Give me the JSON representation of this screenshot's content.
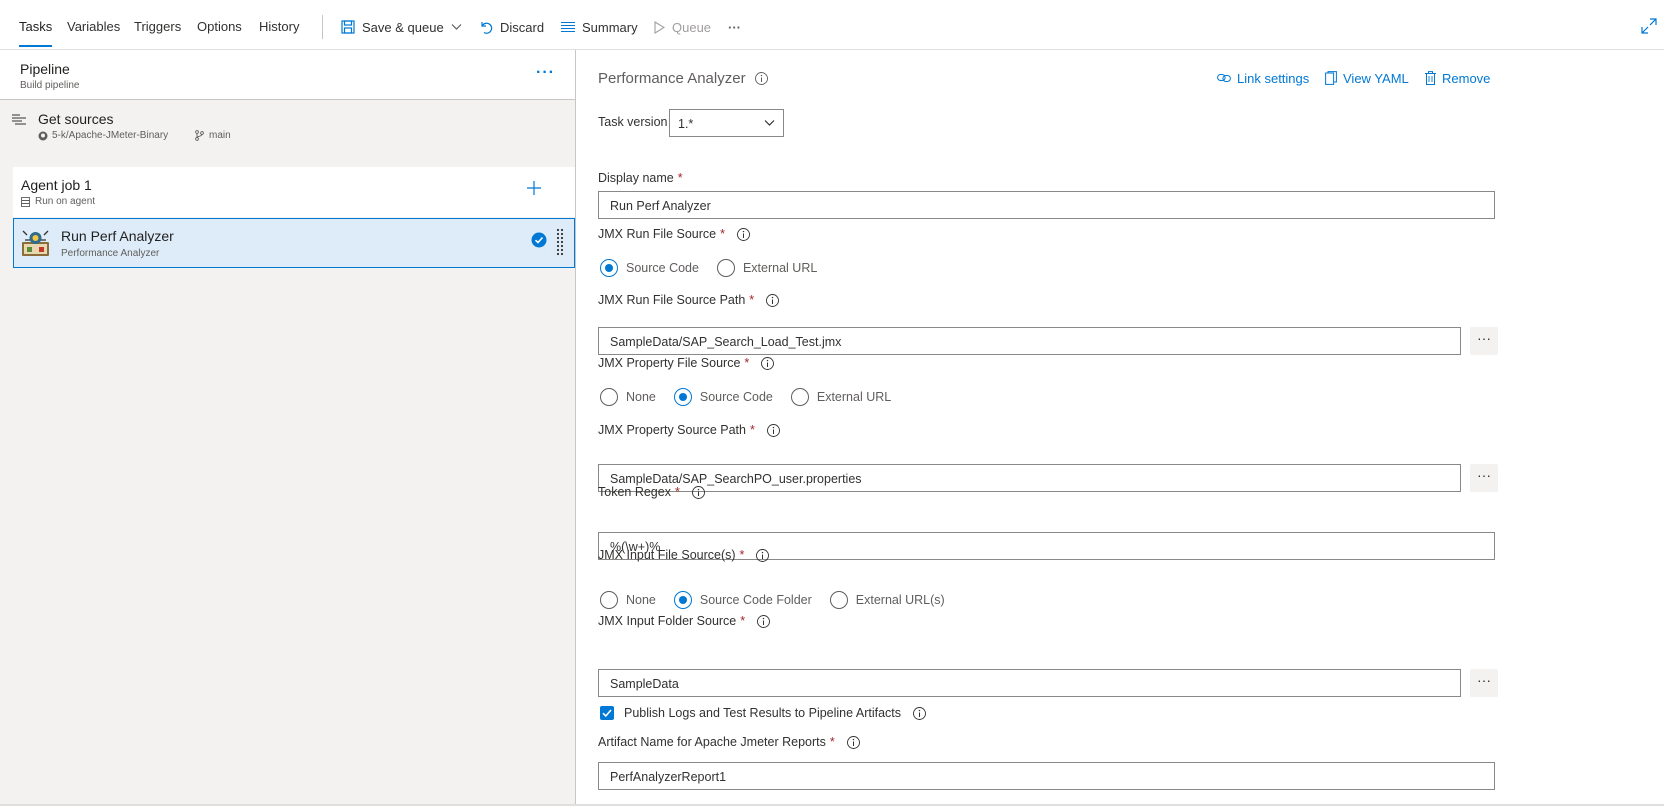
{
  "toolbar": {
    "tabs": [
      {
        "label": "Tasks"
      },
      {
        "label": "Variables"
      },
      {
        "label": "Triggers"
      },
      {
        "label": "Options"
      },
      {
        "label": "History"
      }
    ],
    "save_queue_label": "Save & queue",
    "discard_label": "Discard",
    "summary_label": "Summary",
    "queue_label": "Queue",
    "more_label": "···"
  },
  "pipeline": {
    "title": "Pipeline",
    "subtitle": "Build pipeline",
    "more_label": "···"
  },
  "get_sources": {
    "title": "Get sources",
    "repo": "5-k/Apache-JMeter-Binary",
    "branch": "main"
  },
  "agent_job": {
    "title": "Agent job 1",
    "subtitle": "Run on agent"
  },
  "task": {
    "title": "Run Perf Analyzer",
    "subtitle": "Performance Analyzer"
  },
  "panel": {
    "title": "Performance Analyzer",
    "link_settings": "Link settings",
    "view_yaml": "View YAML",
    "remove": "Remove",
    "task_version_label": "Task version",
    "task_version_value": "1.*",
    "display_name_label": "Display name",
    "display_name_value": "Run Perf Analyzer",
    "run_file_source_label": "JMX Run File Source",
    "run_file_source_options": [
      "Source Code",
      "External URL"
    ],
    "run_file_path_label": "JMX Run File Source Path",
    "run_file_path_value": "SampleData/SAP_Search_Load_Test.jmx",
    "property_file_source_label": "JMX Property File Source",
    "property_file_source_options": [
      "None",
      "Source Code",
      "External URL"
    ],
    "property_path_label": "JMX Property Source Path",
    "property_path_value": "SampleData/SAP_SearchPO_user.properties",
    "token_regex_label": "Token Regex",
    "token_regex_value": "%(\\w+)%",
    "input_file_source_label": "JMX Input File Source(s)",
    "input_file_source_options": [
      "None",
      "Source Code Folder",
      "External URL(s)"
    ],
    "input_folder_label": "JMX Input Folder Source",
    "input_folder_value": "SampleData",
    "publish_label": "Publish Logs and Test Results to Pipeline Artifacts",
    "artifact_name_label": "Artifact Name for Apache Jmeter Reports",
    "artifact_name_value": "PerfAnalyzerReport1",
    "browse_label": "···",
    "required_mark": "*"
  },
  "colors": {
    "accent": "#0078d4",
    "selected_bg": "#deecf9",
    "required": "#a4262c"
  }
}
